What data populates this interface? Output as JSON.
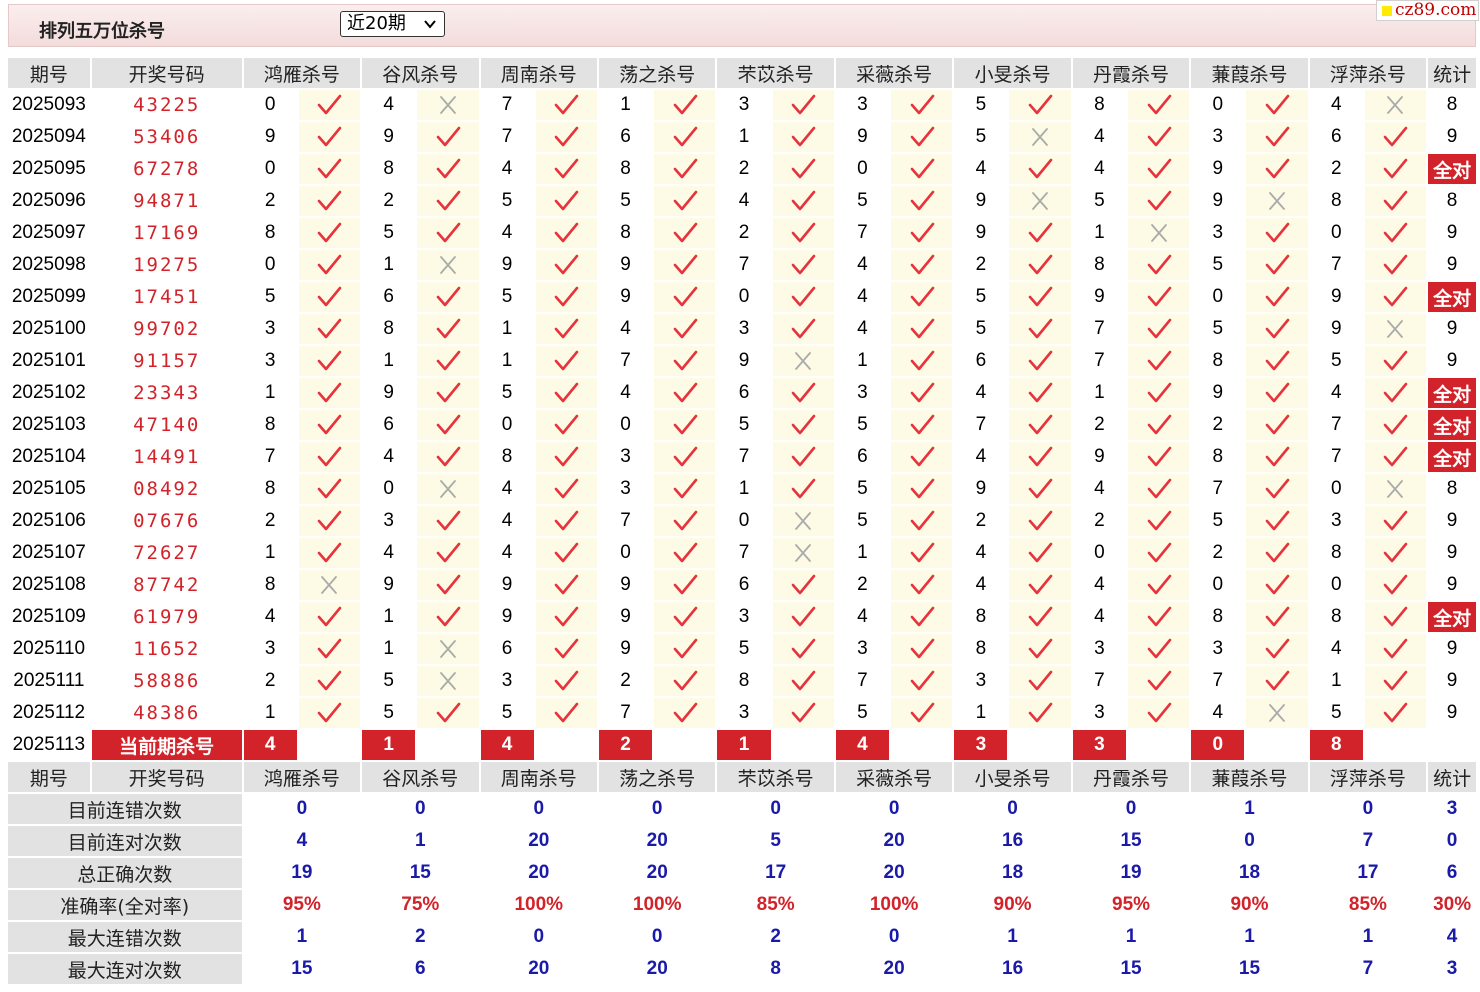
{
  "header": {
    "title": "排列五万位杀号",
    "period_select": "近20期",
    "site_logo": "cz89.com"
  },
  "table": {
    "headers": [
      "期号",
      "开奖号码",
      "鸿雁杀号",
      "谷风杀号",
      "周南杀号",
      "荡之杀号",
      "芣苡杀号",
      "采薇杀号",
      "小旻杀号",
      "丹霞杀号",
      "蒹葭杀号",
      "浮萍杀号",
      "统计"
    ],
    "experts": [
      "鸿雁杀号",
      "谷风杀号",
      "周南杀号",
      "荡之杀号",
      "芣苡杀号",
      "采薇杀号",
      "小旻杀号",
      "丹霞杀号",
      "蒹葭杀号",
      "浮萍杀号"
    ],
    "rows": [
      {
        "issue": "2025093",
        "draw": "43225",
        "kills": [
          "0",
          "4",
          "7",
          "1",
          "3",
          "3",
          "5",
          "8",
          "0",
          "4"
        ],
        "marks": "1011111110",
        "stat": "8"
      },
      {
        "issue": "2025094",
        "draw": "53406",
        "kills": [
          "9",
          "9",
          "7",
          "6",
          "1",
          "9",
          "5",
          "4",
          "3",
          "6"
        ],
        "marks": "1111110111",
        "stat": "9"
      },
      {
        "issue": "2025095",
        "draw": "67278",
        "kills": [
          "0",
          "8",
          "4",
          "8",
          "2",
          "0",
          "4",
          "4",
          "9",
          "2"
        ],
        "marks": "1111111111",
        "stat": "全对"
      },
      {
        "issue": "2025096",
        "draw": "94871",
        "kills": [
          "2",
          "2",
          "5",
          "5",
          "4",
          "5",
          "9",
          "5",
          "9",
          "8"
        ],
        "marks": "1111110101",
        "stat": "8"
      },
      {
        "issue": "2025097",
        "draw": "17169",
        "kills": [
          "8",
          "5",
          "4",
          "8",
          "2",
          "7",
          "9",
          "1",
          "3",
          "0"
        ],
        "marks": "1111111011",
        "stat": "9"
      },
      {
        "issue": "2025098",
        "draw": "19275",
        "kills": [
          "0",
          "1",
          "9",
          "9",
          "7",
          "4",
          "2",
          "8",
          "5",
          "7"
        ],
        "marks": "1011111111",
        "stat": "9"
      },
      {
        "issue": "2025099",
        "draw": "17451",
        "kills": [
          "5",
          "6",
          "5",
          "9",
          "0",
          "4",
          "5",
          "9",
          "0",
          "9"
        ],
        "marks": "1111111111",
        "stat": "全对"
      },
      {
        "issue": "2025100",
        "draw": "99702",
        "kills": [
          "3",
          "8",
          "1",
          "4",
          "3",
          "4",
          "5",
          "7",
          "5",
          "9"
        ],
        "marks": "1111111110",
        "stat": "9"
      },
      {
        "issue": "2025101",
        "draw": "91157",
        "kills": [
          "3",
          "1",
          "1",
          "7",
          "9",
          "1",
          "6",
          "7",
          "8",
          "5"
        ],
        "marks": "1111011111",
        "stat": "9"
      },
      {
        "issue": "2025102",
        "draw": "23343",
        "kills": [
          "1",
          "9",
          "5",
          "4",
          "6",
          "3",
          "4",
          "1",
          "9",
          "4"
        ],
        "marks": "1111111111",
        "stat": "全对"
      },
      {
        "issue": "2025103",
        "draw": "47140",
        "kills": [
          "8",
          "6",
          "0",
          "0",
          "5",
          "5",
          "7",
          "2",
          "2",
          "7"
        ],
        "marks": "1111111111",
        "stat": "全对"
      },
      {
        "issue": "2025104",
        "draw": "14491",
        "kills": [
          "7",
          "4",
          "8",
          "3",
          "7",
          "6",
          "4",
          "9",
          "8",
          "7"
        ],
        "marks": "1111111111",
        "stat": "全对"
      },
      {
        "issue": "2025105",
        "draw": "08492",
        "kills": [
          "8",
          "0",
          "4",
          "3",
          "1",
          "5",
          "9",
          "4",
          "7",
          "0"
        ],
        "marks": "1011111110",
        "stat": "8"
      },
      {
        "issue": "2025106",
        "draw": "07676",
        "kills": [
          "2",
          "3",
          "4",
          "7",
          "0",
          "5",
          "2",
          "2",
          "5",
          "3"
        ],
        "marks": "1111011111",
        "stat": "9"
      },
      {
        "issue": "2025107",
        "draw": "72627",
        "kills": [
          "1",
          "4",
          "4",
          "0",
          "7",
          "1",
          "4",
          "0",
          "2",
          "8"
        ],
        "marks": "1111011111",
        "stat": "9"
      },
      {
        "issue": "2025108",
        "draw": "87742",
        "kills": [
          "8",
          "9",
          "9",
          "9",
          "6",
          "2",
          "4",
          "4",
          "0",
          "0"
        ],
        "marks": "0111111111",
        "stat": "9"
      },
      {
        "issue": "2025109",
        "draw": "61979",
        "kills": [
          "4",
          "1",
          "9",
          "9",
          "3",
          "4",
          "8",
          "4",
          "8",
          "8"
        ],
        "marks": "1111111111",
        "stat": "全对"
      },
      {
        "issue": "2025110",
        "draw": "11652",
        "kills": [
          "3",
          "1",
          "6",
          "9",
          "5",
          "3",
          "8",
          "3",
          "3",
          "4"
        ],
        "marks": "1011111111",
        "stat": "9"
      },
      {
        "issue": "2025111",
        "draw": "58886",
        "kills": [
          "2",
          "5",
          "3",
          "2",
          "8",
          "7",
          "3",
          "7",
          "7",
          "1"
        ],
        "marks": "1011111111",
        "stat": "9"
      },
      {
        "issue": "2025112",
        "draw": "48386",
        "kills": [
          "1",
          "5",
          "5",
          "7",
          "3",
          "5",
          "1",
          "3",
          "4",
          "5"
        ],
        "marks": "1111111101",
        "stat": "9"
      }
    ],
    "current": {
      "issue": "2025113",
      "label": "当前期杀号",
      "kills": [
        "4",
        "1",
        "4",
        "2",
        "1",
        "4",
        "3",
        "3",
        "0",
        "8"
      ]
    }
  },
  "summary": {
    "headers": [
      "期号",
      "开奖号码",
      "鸿雁杀号",
      "谷风杀号",
      "周南杀号",
      "荡之杀号",
      "芣苡杀号",
      "采薇杀号",
      "小旻杀号",
      "丹霞杀号",
      "蒹葭杀号",
      "浮萍杀号",
      "统计"
    ],
    "rows": [
      {
        "label": "目前连错次数",
        "values": [
          "0",
          "0",
          "0",
          "0",
          "0",
          "0",
          "0",
          "0",
          "1",
          "0",
          "3"
        ]
      },
      {
        "label": "目前连对次数",
        "values": [
          "4",
          "1",
          "20",
          "20",
          "5",
          "20",
          "16",
          "15",
          "0",
          "7",
          "0"
        ]
      },
      {
        "label": "总正确次数",
        "values": [
          "19",
          "15",
          "20",
          "20",
          "17",
          "20",
          "18",
          "19",
          "18",
          "17",
          "6"
        ]
      },
      {
        "label": "准确率(全对率)",
        "values": [
          "95%",
          "75%",
          "100%",
          "100%",
          "85%",
          "100%",
          "90%",
          "95%",
          "90%",
          "85%",
          "30%"
        ],
        "rate": true
      },
      {
        "label": "最大连错次数",
        "values": [
          "1",
          "2",
          "0",
          "0",
          "2",
          "0",
          "1",
          "1",
          "1",
          "1",
          "4"
        ]
      },
      {
        "label": "最大连对次数",
        "values": [
          "15",
          "6",
          "20",
          "20",
          "8",
          "20",
          "16",
          "15",
          "15",
          "7",
          "3"
        ]
      }
    ]
  },
  "colors": {
    "accent_red": "#d2232a",
    "stat_blue": "#1a1aa8",
    "mark_bg": "#fdfbe6",
    "header_bg": "#e2e2e2"
  },
  "icons": {
    "correct": "check-icon",
    "wrong": "cross-icon",
    "dropdown": "chevron-down-icon"
  }
}
